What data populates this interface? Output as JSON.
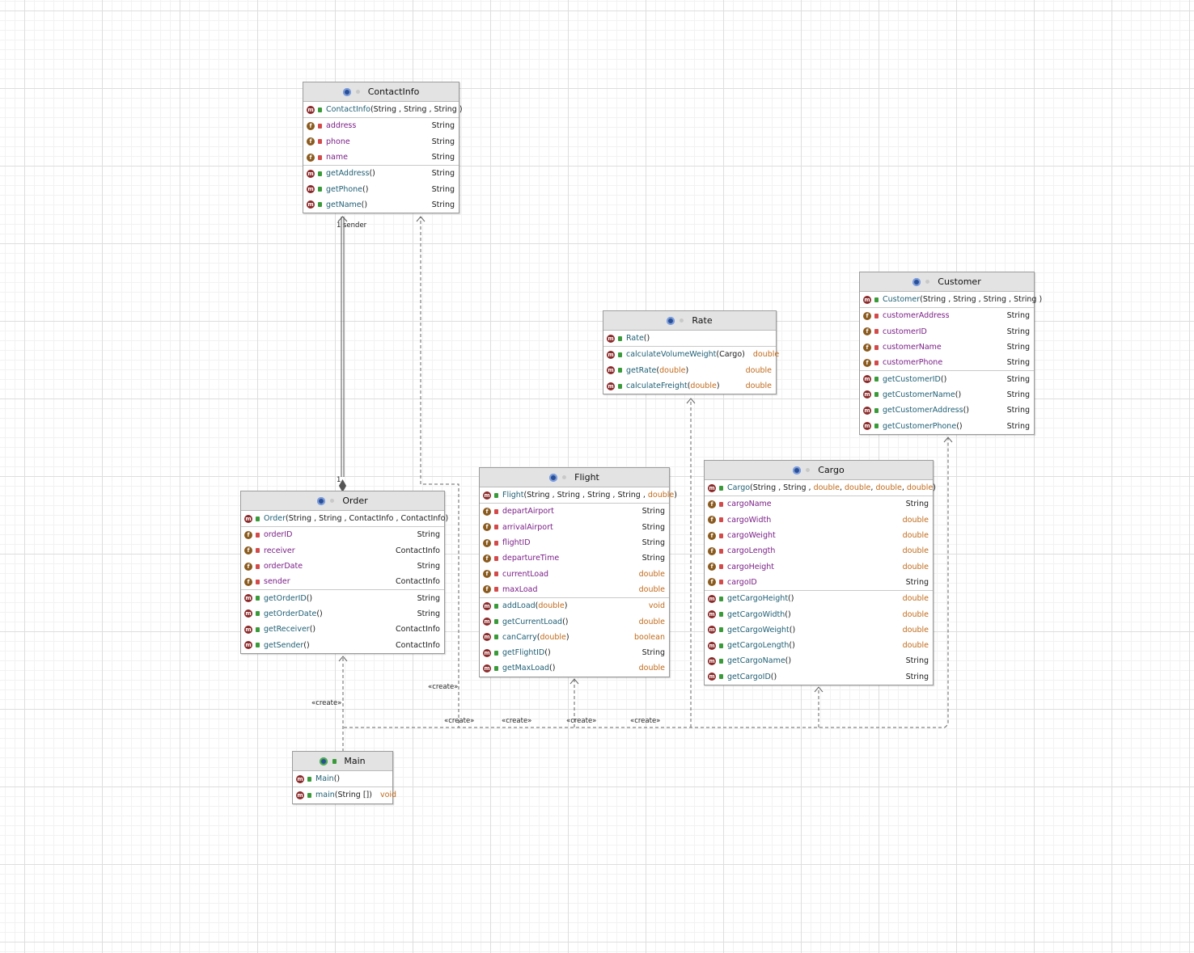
{
  "classes": {
    "contactinfo": {
      "name": "ContactInfo",
      "constructors": [
        {
          "name": "ContactInfo",
          "sig": "(String , String , String )"
        }
      ],
      "fields": [
        {
          "name": "address",
          "type": "String"
        },
        {
          "name": "phone",
          "type": "String"
        },
        {
          "name": "name",
          "type": "String"
        }
      ],
      "methods": [
        {
          "name": "getAddress",
          "sig": " ()",
          "type": "String"
        },
        {
          "name": "getPhone",
          "sig": "()",
          "type": "String"
        },
        {
          "name": "getName",
          "sig": " ()",
          "type": "String"
        }
      ]
    },
    "customer": {
      "name": "Customer",
      "constructors": [
        {
          "name": "Customer",
          "sig": " (String , String , String , String )"
        }
      ],
      "fields": [
        {
          "name": "customerAddress",
          "type": "String"
        },
        {
          "name": "customerID",
          "type": "String"
        },
        {
          "name": "customerName",
          "type": "String"
        },
        {
          "name": "customerPhone",
          "type": "String"
        }
      ],
      "methods": [
        {
          "name": "getCustomerID",
          "sig": "  ()",
          "type": "String"
        },
        {
          "name": "getCustomerName",
          "sig": "   ()",
          "type": "String"
        },
        {
          "name": "getCustomerAddress",
          "sig": "   ()",
          "type": "String"
        },
        {
          "name": "getCustomerPhone",
          "sig": "  ()",
          "type": "String"
        }
      ]
    },
    "rate": {
      "name": "Rate",
      "constructors": [
        {
          "name": "Rate",
          "sig": "()"
        }
      ],
      "fields": [],
      "methods": [
        {
          "name": "calculateVolumeWeight",
          "sig": "  (Cargo)",
          "type": "double"
        },
        {
          "name": "getRate",
          "sig": " (double)",
          "type": "double"
        },
        {
          "name": "calculateFreight",
          "sig": " (double)",
          "type": "double"
        }
      ]
    },
    "order": {
      "name": "Order",
      "constructors": [
        {
          "name": "Order",
          "sig": " (String , String , ContactInfo , ContactInfo)"
        }
      ],
      "fields": [
        {
          "name": "orderID",
          "type": "String"
        },
        {
          "name": "receiver",
          "type": "ContactInfo"
        },
        {
          "name": "orderDate",
          "type": "String"
        },
        {
          "name": "sender",
          "type": "ContactInfo"
        }
      ],
      "methods": [
        {
          "name": "getOrderID",
          "sig": " ()",
          "type": "String"
        },
        {
          "name": "getOrderDate",
          "sig": "  ()",
          "type": "String"
        },
        {
          "name": "getReceiver",
          "sig": " ()",
          "type": "ContactInfo"
        },
        {
          "name": "getSender",
          "sig": " ()",
          "type": "ContactInfo"
        }
      ]
    },
    "flight": {
      "name": "Flight",
      "constructors": [
        {
          "name": "Flight",
          "sig": "(String , String , String , String , double)"
        }
      ],
      "fields": [
        {
          "name": "departAirport",
          "type": "String"
        },
        {
          "name": "arrivalAirport",
          "type": "String"
        },
        {
          "name": "flightID",
          "type": "String"
        },
        {
          "name": "departureTime",
          "type": "String"
        },
        {
          "name": "currentLoad",
          "type": "double"
        },
        {
          "name": "maxLoad",
          "type": "double"
        }
      ],
      "methods": [
        {
          "name": "addLoad",
          "sig": "(double)",
          "type": "void"
        },
        {
          "name": "getCurrentLoad",
          "sig": " ()",
          "type": "double"
        },
        {
          "name": "canCarry",
          "sig": " (double)",
          "type": "boolean"
        },
        {
          "name": "getFlightID",
          "sig": " ()",
          "type": "String"
        },
        {
          "name": "getMaxLoad",
          "sig": "()",
          "type": "double"
        }
      ]
    },
    "cargo": {
      "name": "Cargo",
      "constructors": [
        {
          "name": "Cargo",
          "sig": "(String , String , double, double, double, double)"
        }
      ],
      "fields": [
        {
          "name": "cargoName",
          "type": "String"
        },
        {
          "name": "cargoWidth",
          "type": "double"
        },
        {
          "name": "cargoWeight",
          "type": "double"
        },
        {
          "name": "cargoLength",
          "type": "double"
        },
        {
          "name": "cargoHeight",
          "type": "double"
        },
        {
          "name": "cargoID",
          "type": "String"
        }
      ],
      "methods": [
        {
          "name": "getCargoHeight",
          "sig": " ()",
          "type": "double"
        },
        {
          "name": "getCargoWidth",
          "sig": " ()",
          "type": "double"
        },
        {
          "name": "getCargoWeight",
          "sig": " ()",
          "type": "double"
        },
        {
          "name": "getCargoLength",
          "sig": " ()",
          "type": "double"
        },
        {
          "name": "getCargoName",
          "sig": " ()",
          "type": "String"
        },
        {
          "name": "getCargoID",
          "sig": " ()",
          "type": "String"
        }
      ]
    },
    "main": {
      "name": "Main",
      "constructors": [
        {
          "name": "Main",
          "sig": "()"
        }
      ],
      "fields": [],
      "methods": [
        {
          "name": "main",
          "sig": " (String [])",
          "type": "void",
          "static": true
        }
      ]
    }
  },
  "edge_labels": {
    "sender_mult": "1",
    "sender_role": "sender",
    "order_mult": "1",
    "create_main_order": "«create»",
    "create_main_contactinfo": "«create»",
    "create_main_flight_a": "«create»",
    "create_main_flight_b": "«create»",
    "create_main_cargo": "«create»",
    "create_main_rate": "«create»",
    "create_main_customer": "«create»"
  },
  "colors": {
    "method_name": "#1f5f74",
    "field_name": "#7a1f86",
    "primitive_type": "#c06a1a",
    "header_bg": "#e3e3e3",
    "method_badge": "#8b2a2a",
    "field_badge": "#8a5a1e"
  }
}
